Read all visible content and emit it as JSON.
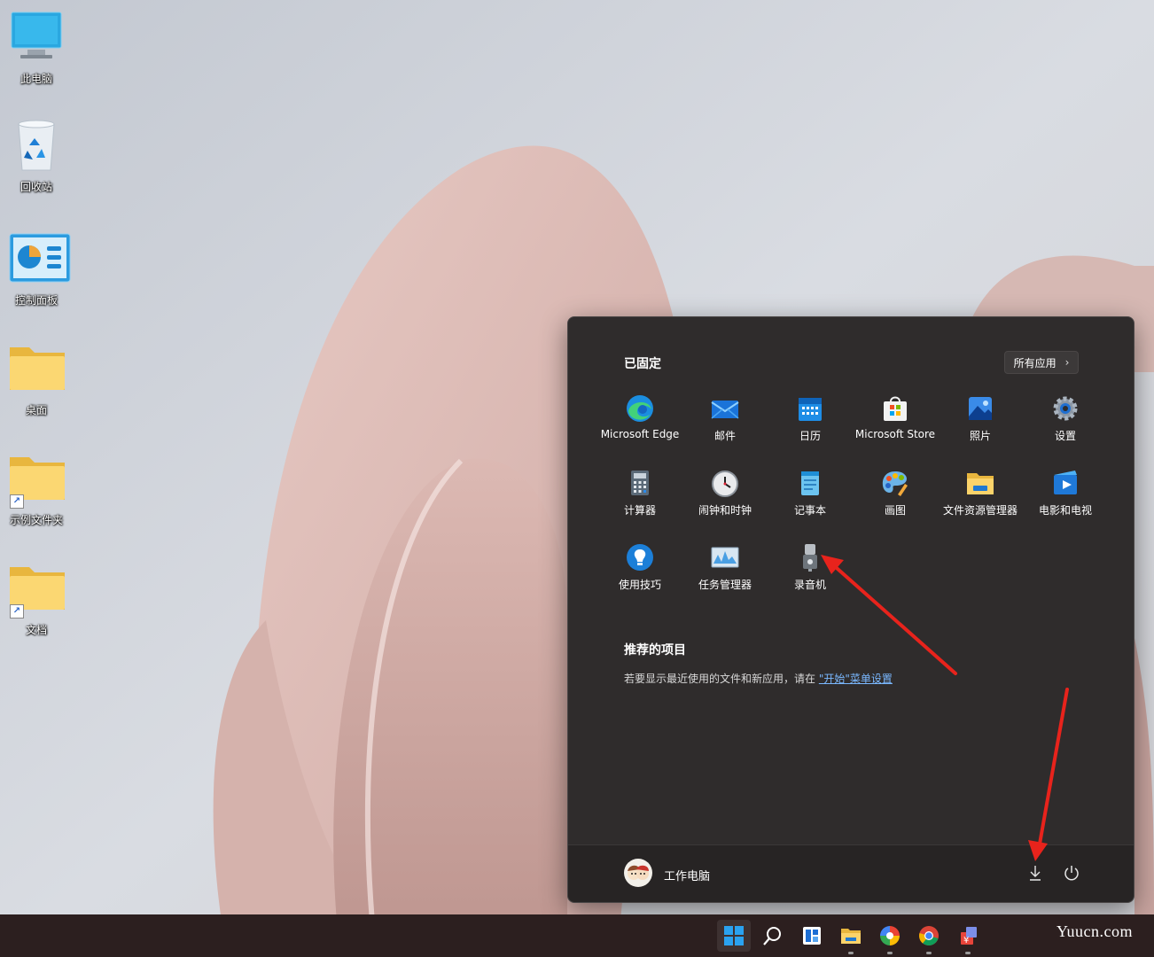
{
  "desktop": {
    "icons": [
      {
        "label": "此电脑",
        "icon": "computer-icon"
      },
      {
        "label": "回收站",
        "icon": "recycle-bin-icon"
      },
      {
        "label": "控制面板",
        "icon": "control-panel-icon"
      },
      {
        "label": "桌面",
        "icon": "folder-icon"
      },
      {
        "label": "示例文件夹",
        "icon": "folder-shortcut-icon"
      },
      {
        "label": "文档",
        "icon": "folder-shortcut-icon"
      }
    ]
  },
  "start_menu": {
    "pinned_title": "已固定",
    "all_apps_label": "所有应用",
    "apps": [
      {
        "label": "Microsoft Edge",
        "icon": "edge-icon"
      },
      {
        "label": "邮件",
        "icon": "mail-icon"
      },
      {
        "label": "日历",
        "icon": "calendar-icon"
      },
      {
        "label": "Microsoft Store",
        "icon": "store-icon"
      },
      {
        "label": "照片",
        "icon": "photos-icon"
      },
      {
        "label": "设置",
        "icon": "settings-gear-icon"
      },
      {
        "label": "计算器",
        "icon": "calculator-icon"
      },
      {
        "label": "闹钟和时钟",
        "icon": "clock-icon"
      },
      {
        "label": "记事本",
        "icon": "notepad-icon"
      },
      {
        "label": "画图",
        "icon": "paint-icon"
      },
      {
        "label": "文件资源管理器",
        "icon": "file-explorer-icon"
      },
      {
        "label": "电影和电视",
        "icon": "movies-tv-icon"
      },
      {
        "label": "使用技巧",
        "icon": "tips-icon"
      },
      {
        "label": "任务管理器",
        "icon": "task-manager-icon"
      },
      {
        "label": "录音机",
        "icon": "voice-recorder-icon"
      }
    ],
    "recommended_title": "推荐的项目",
    "recommended_text": "若要显示最近使用的文件和新应用，请在 ",
    "recommended_link": "\"开始\"菜单设置",
    "user_name": "工作电脑"
  },
  "taskbar": {
    "items": [
      "start-icon",
      "search-icon",
      "widgets-icon",
      "file-explorer-icon",
      "photos-app-icon",
      "chrome-icon",
      "money-app-icon"
    ]
  },
  "watermark": "Yuucn.com",
  "colors": {
    "menu_bg": "#2f2c2c",
    "taskbar_bg": "#2c1f1f",
    "link": "#7ab8ff",
    "annotation_arrow": "#e8231c"
  }
}
